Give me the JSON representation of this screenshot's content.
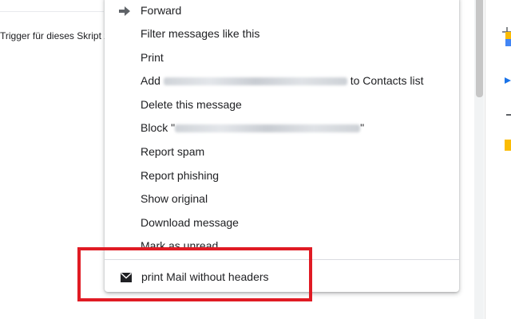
{
  "background": {
    "trigger_text": "Trigger für dieses Skript z"
  },
  "menu": {
    "items": [
      {
        "name": "forward",
        "label": "Forward",
        "icon": "forward-arrow-icon"
      },
      {
        "name": "filter-messages",
        "label": "Filter messages like this"
      },
      {
        "name": "print",
        "label": "Print"
      },
      {
        "name": "add-to-contacts",
        "label_prefix": "Add",
        "label_suffix": "to Contacts list"
      },
      {
        "name": "delete-message",
        "label": "Delete this message"
      },
      {
        "name": "block-sender",
        "label_prefix": "Block \"",
        "label_suffix": "\""
      },
      {
        "name": "report-spam",
        "label": "Report spam"
      },
      {
        "name": "report-phishing",
        "label": "Report phishing"
      },
      {
        "name": "show-original",
        "label": "Show original"
      },
      {
        "name": "download-message",
        "label": "Download message"
      },
      {
        "name": "mark-as-unread",
        "label": "Mark as unread"
      }
    ],
    "addon_item": {
      "label": "print Mail without headers",
      "icon": "envelope-icon"
    }
  },
  "colors": {
    "highlight": "#e01b24",
    "text": "#202124",
    "divider": "#dadce0"
  }
}
